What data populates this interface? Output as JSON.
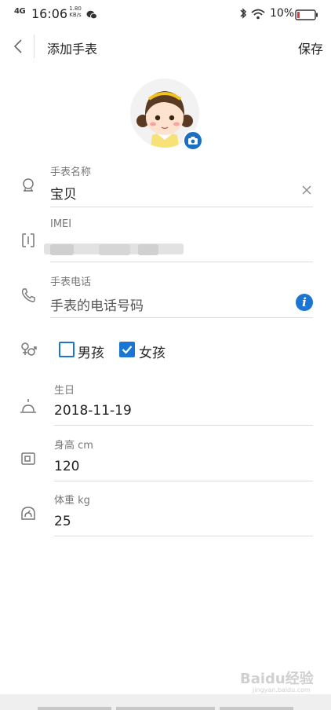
{
  "status_bar": {
    "network": "4G",
    "time": "16:06",
    "speed_value": "1.80",
    "speed_unit": "KB/s",
    "battery_text": "10%",
    "icons": [
      "signal-icon",
      "wechat-icon",
      "bluetooth-icon",
      "wifi-icon",
      "battery-icon"
    ]
  },
  "header": {
    "title": "添加手表",
    "save_label": "保存"
  },
  "form": {
    "name": {
      "label": "手表名称",
      "value": "宝贝"
    },
    "imei": {
      "label": "IMEI"
    },
    "phone": {
      "label": "手表电话",
      "placeholder": "手表的电话号码"
    },
    "gender": {
      "options": [
        {
          "label": "男孩",
          "checked": false
        },
        {
          "label": "女孩",
          "checked": true
        }
      ]
    },
    "birthday": {
      "label": "生日",
      "value": "2018-11-19"
    },
    "height": {
      "label": "身高 cm",
      "value": "120"
    },
    "weight": {
      "label": "体重 kg",
      "value": "25"
    }
  },
  "watermark": {
    "text": "Baidu经验",
    "sub": "jingyan.baidu.com"
  },
  "colors": {
    "accent": "#1a76d2",
    "divider": "#dcdcdc",
    "label": "#777777"
  }
}
